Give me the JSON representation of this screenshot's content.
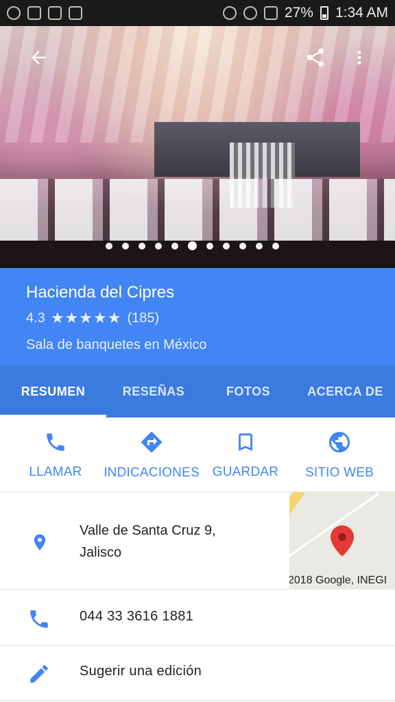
{
  "status_bar": {
    "battery_text": "27%",
    "time": "1:34 AM"
  },
  "hero": {
    "photo_count": 11,
    "active_index": 5
  },
  "place": {
    "name": "Hacienda del Cipres",
    "rating": "4.3",
    "stars": "★★★★★",
    "reviews": "(185)",
    "category": "Sala de banquetes en México"
  },
  "tabs": [
    {
      "label": "RESUMEN"
    },
    {
      "label": "RESEÑAS"
    },
    {
      "label": "FOTOS"
    },
    {
      "label": "ACERCA DE"
    }
  ],
  "actions": [
    {
      "label": "LLAMAR",
      "icon": "phone-icon"
    },
    {
      "label": "INDICACIONES",
      "icon": "directions-icon"
    },
    {
      "label": "GUARDAR",
      "icon": "bookmark-icon"
    },
    {
      "label": "SITIO WEB",
      "icon": "globe-icon"
    }
  ],
  "address": {
    "line1": "Valle de Santa Cruz 9,",
    "line2": "Jalisco",
    "map_attribution": "2018 Google, INEGI"
  },
  "phone": "044 33 3616 1881",
  "suggest_edit": "Sugerir una edición",
  "colors": {
    "brand_blue": "#4285f4",
    "tab_bar": "#3b7be0",
    "pin_red": "#e53935"
  }
}
